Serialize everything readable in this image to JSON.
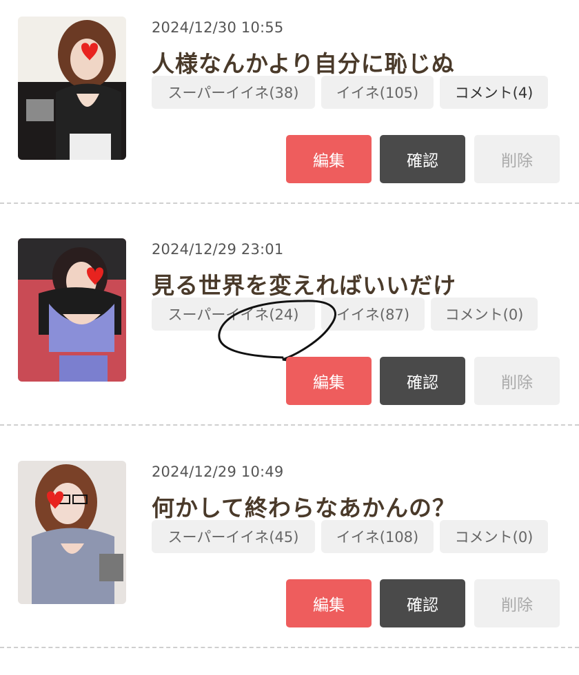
{
  "posts": [
    {
      "date": "2024/12/30 10:55",
      "title": "人様なんかより自分に恥じぬ",
      "super_like": "スーパーイイネ(38)",
      "like": "イイネ(105)",
      "comment": "コメント(4)",
      "edit_label": "編集",
      "confirm_label": "確認",
      "delete_label": "削除"
    },
    {
      "date": "2024/12/29 23:01",
      "title": "見る世界を変えればいいだけ",
      "super_like": "スーパーイイネ(24)",
      "like": "イイネ(87)",
      "comment": "コメント(0)",
      "edit_label": "編集",
      "confirm_label": "確認",
      "delete_label": "削除"
    },
    {
      "date": "2024/12/29 10:49",
      "title": "何かして終わらなあかんの？",
      "super_like": "スーパーイイネ(45)",
      "like": "イイネ(108)",
      "comment": "コメント(0)",
      "edit_label": "編集",
      "confirm_label": "確認",
      "delete_label": "削除"
    }
  ],
  "colors": {
    "edit": "#ee5d5d",
    "confirm": "#4a4a4a",
    "delete_bg": "#f0f0f0",
    "title": "#4a3a2a",
    "heart_sticker": "#e8231f"
  },
  "icons": [
    "heart-sticker-icon"
  ]
}
